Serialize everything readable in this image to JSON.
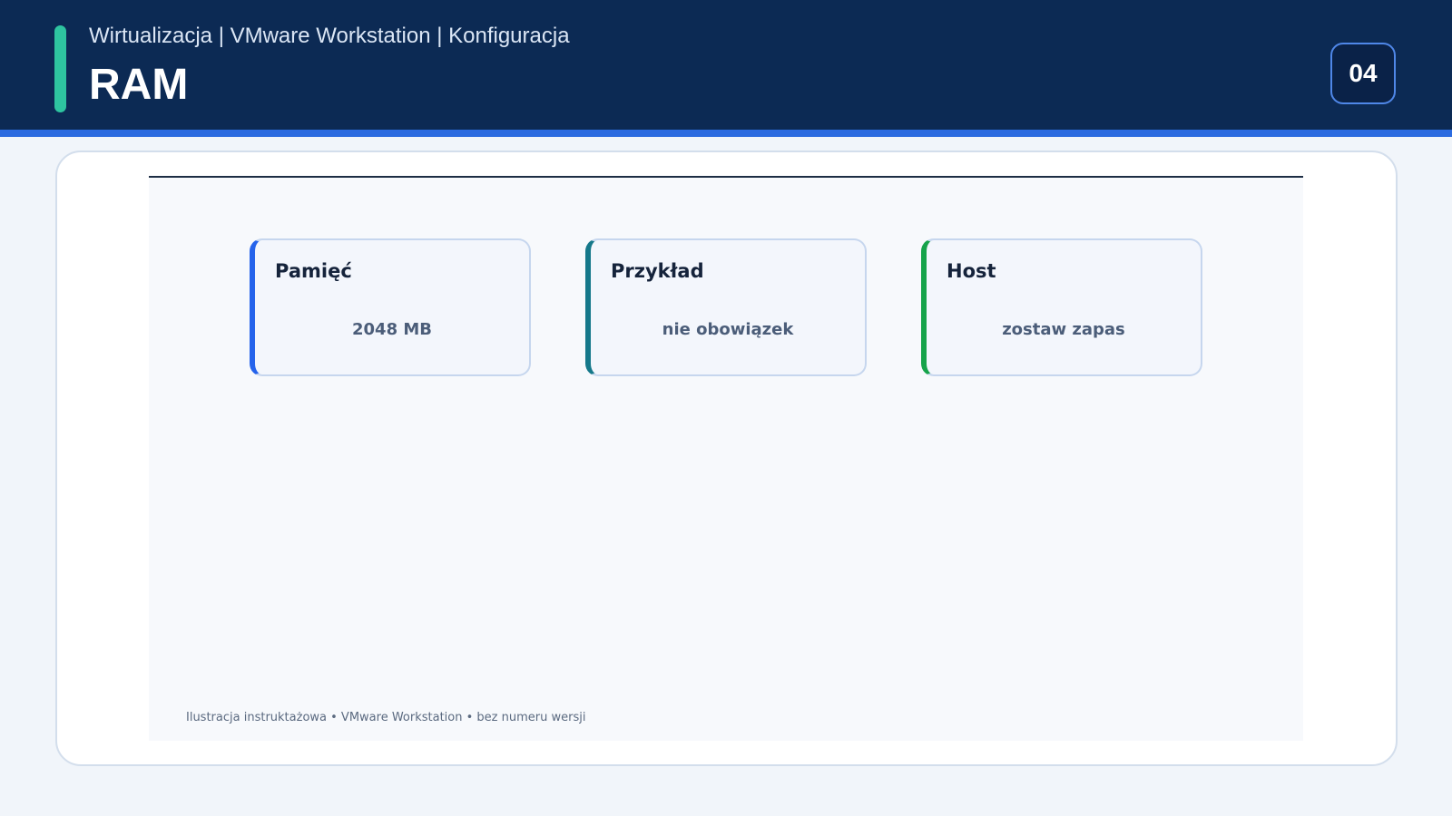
{
  "header": {
    "breadcrumb": "Wirtualizacja | VMware Workstation | Konfiguracja",
    "title": "RAM",
    "page_number": "04"
  },
  "cards": [
    {
      "title": "Pamięć",
      "value": "2048 MB",
      "accent": "#2563eb"
    },
    {
      "title": "Przykład",
      "value": "nie obowiązek",
      "accent": "#15788a"
    },
    {
      "title": "Host",
      "value": "zostaw zapas",
      "accent": "#16a34a"
    }
  ],
  "footer": {
    "note": "Ilustracja instruktażowa • VMware Workstation • bez numeru wersji"
  },
  "colors": {
    "header_bg": "#0c2a54",
    "header_strip": "#2b6be0",
    "accent_bar": "#2ec4a0"
  }
}
